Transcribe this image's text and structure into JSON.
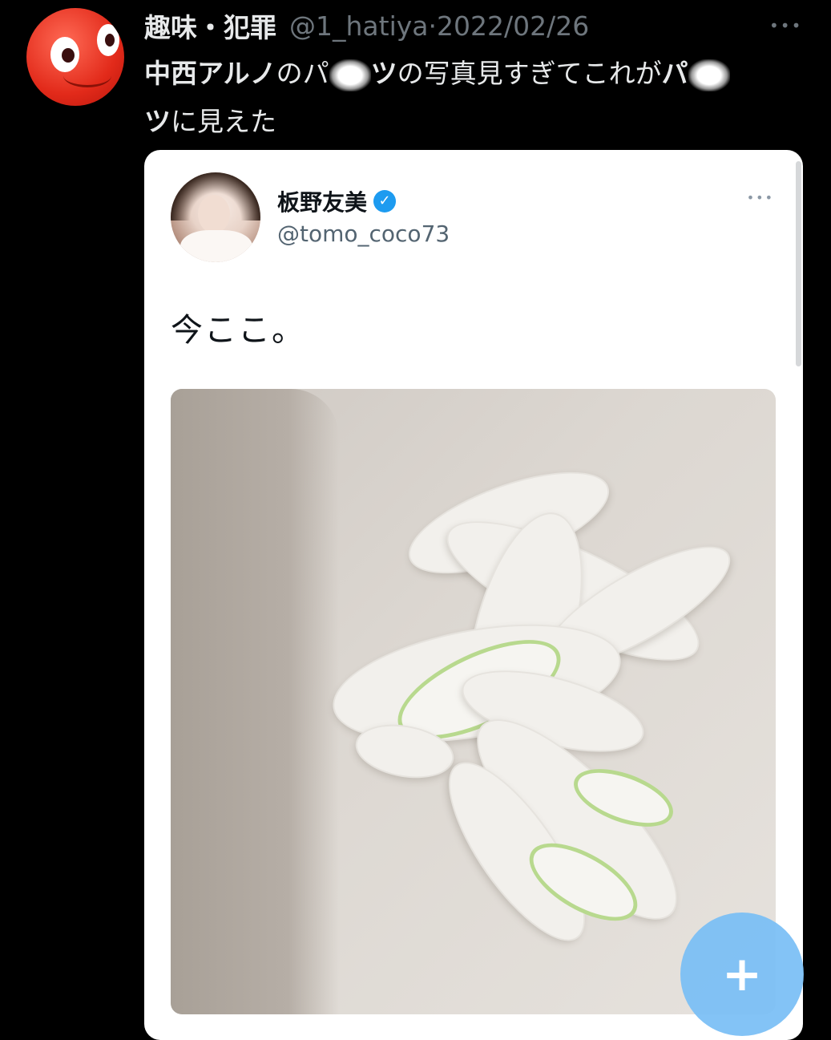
{
  "tweet": {
    "display_name": "趣味・犯罪",
    "handle": "@1_hatiya",
    "separator": "·",
    "date": "2022/02/26",
    "more": "•••",
    "text_part1": "中西アルノ",
    "text_part2": "のパ",
    "text_part3": "ツ",
    "text_part4": "の写真見すぎてこれが",
    "text_part5": "パ",
    "text_part6": "ツ",
    "text_part7": "に見えた"
  },
  "quoted": {
    "display_name": "板野友美",
    "verified_glyph": "✓",
    "handle": "@tomo_coco73",
    "more": "•••",
    "text": "今ここ。"
  },
  "fab": {
    "label": "+"
  },
  "colors": {
    "accent": "#1d9bf0",
    "background": "#000000",
    "fab": "#78bef5"
  }
}
